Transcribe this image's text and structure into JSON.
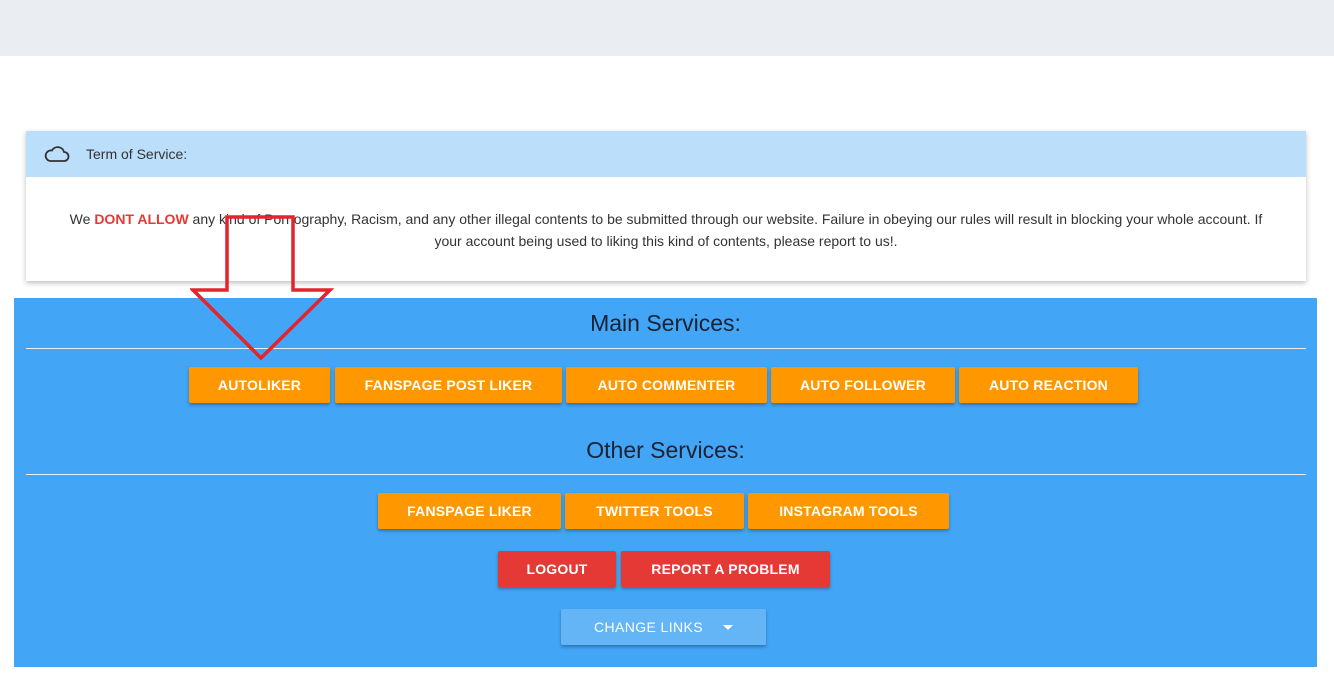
{
  "tos": {
    "title": "Term of Service:",
    "text_before": "We ",
    "highlight": "DONT ALLOW",
    "text_after": " any kind of Pornography, Racism, and any other illegal contents to be submitted through our website. Failure in obeying our rules will result in blocking your whole account. If your account being used to liking this kind of contents, please report to us!."
  },
  "main_services": {
    "title": "Main Services:",
    "buttons": [
      "AUTOLIKER",
      "FANSPAGE POST LIKER",
      "AUTO COMMENTER",
      "AUTO FOLLOWER",
      "AUTO REACTION"
    ]
  },
  "other_services": {
    "title": "Other Services:",
    "buttons": [
      "FANSPAGE LIKER",
      "TWITTER TOOLS",
      "INSTAGRAM TOOLS"
    ]
  },
  "account": {
    "logout": "LOGOUT",
    "report": "REPORT A PROBLEM"
  },
  "change_links": "CHANGE LINKS",
  "colors": {
    "accent_orange": "#ff9800",
    "danger_red": "#e53935",
    "panel_blue": "#42a5f5",
    "header_blue": "#bbdefb",
    "annotation_arrow": "#e3232d"
  },
  "icons": {
    "tos_header": "cloud-icon",
    "change_links": "caret-down-icon"
  }
}
